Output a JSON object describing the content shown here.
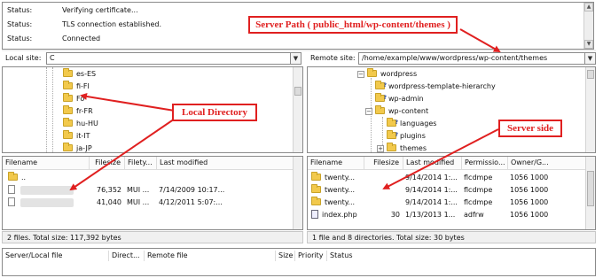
{
  "log": [
    {
      "label": "Status:",
      "text": "Verifying certificate..."
    },
    {
      "label": "Status:",
      "text": "TLS connection established."
    },
    {
      "label": "Status:",
      "text": "Connected"
    }
  ],
  "local": {
    "site_label": "Local site:",
    "path": "C",
    "tree": [
      "es-ES",
      "fi-FI",
      "Fo",
      "fr-FR",
      "hu-HU",
      "it-IT",
      "ja-JP"
    ],
    "columns": [
      "Filename",
      "Filesize",
      "Filety...",
      "Last modified"
    ],
    "files": [
      {
        "name": "..",
        "size": "",
        "type": "",
        "modified": ""
      },
      {
        "name": "",
        "size": "76,352",
        "type": "MUI ...",
        "modified": "7/14/2009 10:17..."
      },
      {
        "name": "",
        "size": "41,040",
        "type": "MUI ...",
        "modified": "4/12/2011 5:07:..."
      }
    ],
    "status": "2 files. Total size: 117,392 bytes"
  },
  "remote": {
    "site_label": "Remote site:",
    "path": "/home/example/www/wordpress/wp-content/themes",
    "tree": [
      {
        "label": "wordpress",
        "expander": "−",
        "q": false
      },
      {
        "label": "wordpress-template-hierarchy",
        "expander": "",
        "q": true
      },
      {
        "label": "wp-admin",
        "expander": "",
        "q": true
      },
      {
        "label": "wp-content",
        "expander": "−",
        "q": false
      },
      {
        "label": "languages",
        "expander": "",
        "q": true
      },
      {
        "label": "plugins",
        "expander": "",
        "q": true
      },
      {
        "label": "themes",
        "expander": "+",
        "q": false
      }
    ],
    "columns": [
      "Filename",
      "Filesize",
      "Last modified",
      "Permissio...",
      "Owner/G..."
    ],
    "files": [
      {
        "name": "twenty...",
        "size": "",
        "modified": "9/14/2014 1:...",
        "perms": "flcdmpe",
        "owner": "1056 1000",
        "kind": "folder"
      },
      {
        "name": "twenty...",
        "size": "",
        "modified": "9/14/2014 1:...",
        "perms": "flcdmpe",
        "owner": "1056 1000",
        "kind": "folder"
      },
      {
        "name": "twenty...",
        "size": "",
        "modified": "9/14/2014 1:...",
        "perms": "flcdmpe",
        "owner": "1056 1000",
        "kind": "folder"
      },
      {
        "name": "index.php",
        "size": "30",
        "modified": "1/13/2013 1...",
        "perms": "adfrw",
        "owner": "1056 1000",
        "kind": "php"
      }
    ],
    "status": "1 file and 8 directories. Total size: 30 bytes"
  },
  "queue": {
    "columns": [
      "Server/Local file",
      "Direct...",
      "Remote file",
      "Size",
      "Priority",
      "Status"
    ]
  },
  "annotations": {
    "server_path": "Server Path ( public_html/wp-content/themes )",
    "local_directory": "Local Directory",
    "server_side": "Server side",
    "color": "#e02020"
  },
  "colors": {
    "folder": "#f2c94c",
    "border": "#8a8a8a",
    "statusbar": "#f0f0f0"
  }
}
